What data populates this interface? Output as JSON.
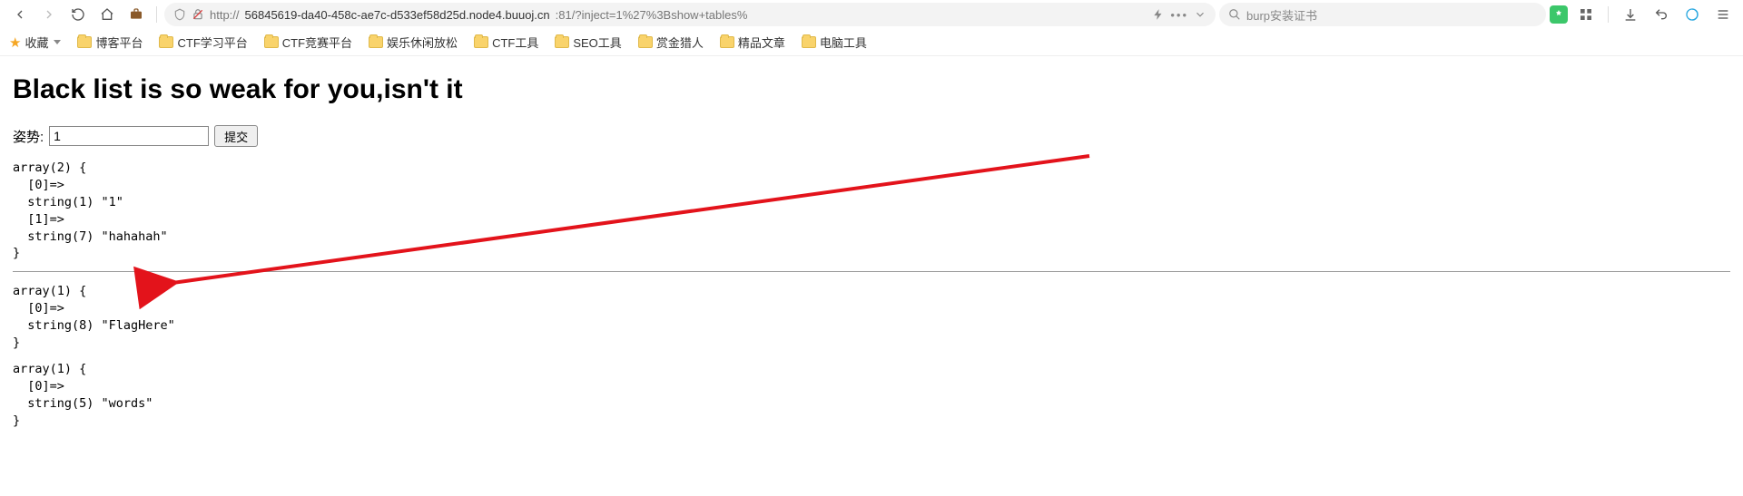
{
  "toolbar": {
    "url_prefix": "http://",
    "url_host": "56845619-da40-458c-ae7c-d533ef58d25d.node4.buuoj.cn",
    "url_rest": ":81/?inject=1%27%3Bshow+tables%",
    "search_text": "burp安装证书"
  },
  "bookmarks": {
    "fav_label": "收藏",
    "items": [
      "博客平台",
      "CTF学习平台",
      "CTF竞赛平台",
      "娱乐休闲放松",
      "CTF工具",
      "SEO工具",
      "赏金猎人",
      "精品文章",
      "电脑工具"
    ]
  },
  "page": {
    "heading": "Black list is so weak for you,isn't it",
    "form_label": "姿势:",
    "input_value": "1",
    "submit_label": "提交",
    "block1": "array(2) {\n  [0]=>\n  string(1) \"1\"\n  [1]=>\n  string(7) \"hahahah\"\n}",
    "block2": "array(1) {\n  [0]=>\n  string(8) \"FlagHere\"\n}",
    "block3": "array(1) {\n  [0]=>\n  string(5) \"words\"\n}"
  }
}
